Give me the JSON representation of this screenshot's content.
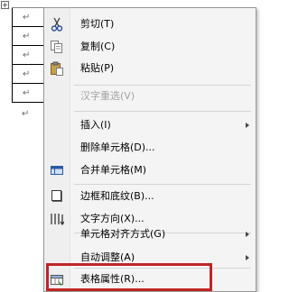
{
  "document": {
    "table_handle_glyph": "+",
    "paragraph_mark": "↵"
  },
  "context_menu": {
    "items": [
      {
        "label": "剪切(T)",
        "icon": "scissors-icon",
        "enabled": true
      },
      {
        "label": "复制(C)",
        "icon": "copy-icon",
        "enabled": true
      },
      {
        "label": "粘贴(P)",
        "icon": "paste-icon",
        "enabled": true
      },
      {
        "label": "汉字重选(V)",
        "icon": "",
        "enabled": false
      },
      {
        "label": "插入(I)",
        "icon": "",
        "enabled": true,
        "submenu": true
      },
      {
        "label": "删除单元格(D)...",
        "icon": "",
        "enabled": true
      },
      {
        "label": "合并单元格(M)",
        "icon": "merge-cells-icon",
        "enabled": true
      },
      {
        "label": "边框和底纹(B)...",
        "icon": "borders-icon",
        "enabled": true
      },
      {
        "label": "文字方向(X)...",
        "icon": "text-direction-icon",
        "enabled": true
      },
      {
        "label": "单元格对齐方式(G)",
        "icon": "",
        "enabled": true,
        "submenu": true
      },
      {
        "label": "自动调整(A)",
        "icon": "",
        "enabled": true,
        "submenu": true
      },
      {
        "label": "表格属性(R)...",
        "icon": "table-properties-icon",
        "enabled": true,
        "highlighted": true
      }
    ]
  },
  "colors": {
    "menu_background": "#f4f4f4",
    "disabled_text": "#a3a3a3",
    "highlight_border": "#c02525",
    "selected_cell": "#c5d3e8"
  }
}
